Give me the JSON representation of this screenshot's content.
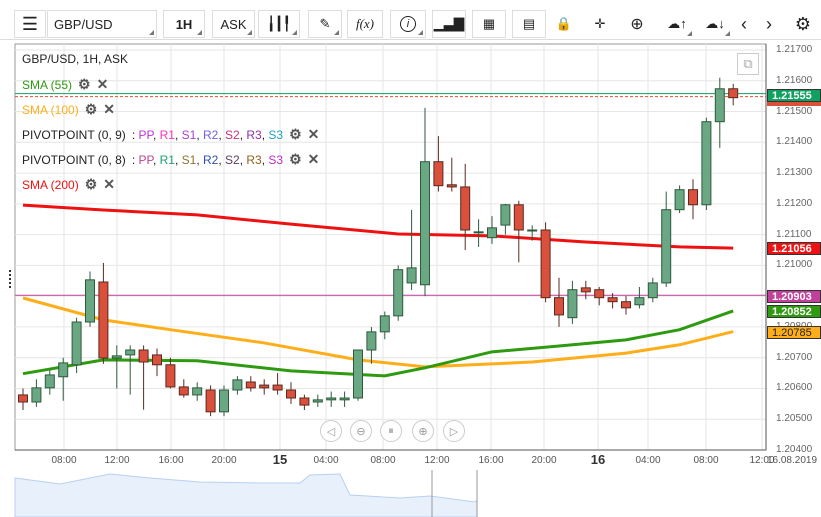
{
  "toolbar": {
    "symbol": "GBP/USD",
    "timeframe": "1H",
    "side": "ASK",
    "fx": "f(x)",
    "icons": [
      "menu-icon",
      "candlestick-icon",
      "pen-icon",
      "function-icon",
      "info-icon",
      "bar-chart-icon",
      "calendar-icon",
      "document-icon",
      "lock-icon",
      "crosshair-icon",
      "zoom-icon",
      "cloud-upload-icon",
      "cloud-download-icon",
      "chevron-left-icon",
      "chevron-right-icon",
      "gear-icon"
    ]
  },
  "legend": {
    "title": "GBP/USD, 1H, ASK",
    "sma55": "SMA (55)",
    "sma100": "SMA (100)",
    "sma200": "SMA (200)",
    "pivot9": {
      "label": "PIVOTPOINT (0, 9)",
      "items": [
        {
          "t": "PP",
          "c": "#c030e0"
        },
        {
          "t": "R1",
          "c": "#ff30c0"
        },
        {
          "t": "S1",
          "c": "#b040d0"
        },
        {
          "t": "R2",
          "c": "#7060e0"
        },
        {
          "t": "S2",
          "c": "#c03080"
        },
        {
          "t": "R3",
          "c": "#9030b0"
        },
        {
          "t": "S3",
          "c": "#20a0c0"
        }
      ]
    },
    "pivot8": {
      "label": "PIVOTPOINT (0, 8)",
      "items": [
        {
          "t": "PP",
          "c": "#c04090"
        },
        {
          "t": "R1",
          "c": "#20a070"
        },
        {
          "t": "S1",
          "c": "#907030"
        },
        {
          "t": "R2",
          "c": "#3050b0"
        },
        {
          "t": "S2",
          "c": "#604060"
        },
        {
          "t": "R3",
          "c": "#906020"
        },
        {
          "t": "S3",
          "c": "#c030c0"
        }
      ]
    }
  },
  "colors": {
    "up": "#6aa884",
    "down": "#d9513c",
    "sma55": "#2e9a10",
    "sma100": "#ffae1a",
    "sma200": "#ee1111",
    "pivot": "#c0409a",
    "price": "#10a060"
  },
  "yaxis": {
    "min": 1.204,
    "max": 1.217,
    "ticks": [
      "1.21700",
      "1.21600",
      "1.21500",
      "1.21400",
      "1.21300",
      "1.21200",
      "1.21100",
      "1.21000",
      "1.20900",
      "1.20800",
      "1.20700",
      "1.20600",
      "1.20500",
      "1.20400"
    ]
  },
  "tags": {
    "price": "1.21555",
    "sma200": "1.21056",
    "pivot": "1.20903",
    "sma55": "1.20852",
    "sma100": "1.20785"
  },
  "xaxis": [
    "08:00",
    "12:00",
    "16:00",
    "20:00",
    "15",
    "04:00",
    "08:00",
    "12:00",
    "16:00",
    "20:00",
    "16",
    "04:00",
    "08:00",
    "12:00",
    "16.08.2019"
  ],
  "chart_data": {
    "type": "candlestick",
    "pivot_level": 1.20903,
    "last_price": 1.21555,
    "candles": [
      [
        1.20579,
        1.206,
        1.2053,
        1.20556
      ],
      [
        1.20556,
        1.2063,
        1.2054,
        1.20602
      ],
      [
        1.20602,
        1.2066,
        1.2058,
        1.20644
      ],
      [
        1.20638,
        1.207,
        1.2056,
        1.20683
      ],
      [
        1.20677,
        1.2083,
        1.2065,
        1.20816
      ],
      [
        1.20816,
        1.2098,
        1.208,
        1.20953
      ],
      [
        1.20946,
        1.21008,
        1.2068,
        1.20699
      ],
      [
        1.20699,
        1.2074,
        1.206,
        1.20706
      ],
      [
        1.20709,
        1.2074,
        1.2058,
        1.20725
      ],
      [
        1.20725,
        1.2074,
        1.20531,
        1.20686
      ],
      [
        1.20709,
        1.2073,
        1.2064,
        1.20677
      ],
      [
        1.20677,
        1.207,
        1.206,
        1.20605
      ],
      [
        1.20605,
        1.2063,
        1.2057,
        1.20579
      ],
      [
        1.20579,
        1.2062,
        1.2056,
        1.20602
      ],
      [
        1.20595,
        1.2061,
        1.2051,
        1.20524
      ],
      [
        1.20524,
        1.2061,
        1.2051,
        1.20595
      ],
      [
        1.20595,
        1.2064,
        1.2058,
        1.20628
      ],
      [
        1.20621,
        1.2064,
        1.2059,
        1.20602
      ],
      [
        1.20611,
        1.2063,
        1.2058,
        1.20602
      ],
      [
        1.20611,
        1.2065,
        1.2058,
        1.20595
      ],
      [
        1.20595,
        1.2062,
        1.2055,
        1.20569
      ],
      [
        1.20569,
        1.2058,
        1.2053,
        1.20546
      ],
      [
        1.20556,
        1.2058,
        1.2054,
        1.20563
      ],
      [
        1.20563,
        1.2059,
        1.2054,
        1.20569
      ],
      [
        1.20563,
        1.2059,
        1.2054,
        1.20569
      ],
      [
        1.20569,
        1.2072,
        1.2056,
        1.20725
      ],
      [
        1.20725,
        1.208,
        1.2068,
        1.20784
      ],
      [
        1.20784,
        1.2085,
        1.2076,
        1.20836
      ],
      [
        1.20836,
        1.21,
        1.2082,
        1.20986
      ],
      [
        1.20943,
        1.2118,
        1.2092,
        1.20992
      ],
      [
        1.20937,
        1.21512,
        1.209,
        1.21337
      ],
      [
        1.21337,
        1.2142,
        1.2124,
        1.21259
      ],
      [
        1.21262,
        1.2135,
        1.2124,
        1.21255
      ],
      [
        1.21255,
        1.2133,
        1.2105,
        1.21115
      ],
      [
        1.21109,
        1.2115,
        1.2106,
        1.21109
      ],
      [
        1.2109,
        1.2116,
        1.2107,
        1.21122
      ],
      [
        1.21131,
        1.212,
        1.211,
        1.21197
      ],
      [
        1.21197,
        1.2121,
        1.2101,
        1.21115
      ],
      [
        1.21115,
        1.2113,
        1.2108,
        1.21115
      ],
      [
        1.21115,
        1.2114,
        1.2088,
        1.20895
      ],
      [
        1.20895,
        1.2096,
        1.208,
        1.20839
      ],
      [
        1.2083,
        1.2095,
        1.2081,
        1.20921
      ],
      [
        1.20927,
        1.2095,
        1.2089,
        1.20914
      ],
      [
        1.20921,
        1.2093,
        1.2087,
        1.20895
      ],
      [
        1.20895,
        1.2091,
        1.2086,
        1.20882
      ],
      [
        1.20882,
        1.209,
        1.2084,
        1.20862
      ],
      [
        1.20872,
        1.2093,
        1.2086,
        1.20895
      ],
      [
        1.20895,
        1.2096,
        1.2088,
        1.20943
      ],
      [
        1.20943,
        1.2124,
        1.2093,
        1.21181
      ],
      [
        1.21181,
        1.2126,
        1.2117,
        1.21246
      ],
      [
        1.21246,
        1.2128,
        1.2115,
        1.21197
      ],
      [
        1.21197,
        1.2148,
        1.2118,
        1.21467
      ],
      [
        1.21467,
        1.2161,
        1.21382,
        1.21574
      ],
      [
        1.21574,
        1.2159,
        1.2152,
        1.21545
      ]
    ],
    "sma55": [
      [
        0,
        1.20648
      ],
      [
        6,
        1.20693
      ],
      [
        13,
        1.2069
      ],
      [
        20,
        1.20657
      ],
      [
        27,
        1.20641
      ],
      [
        30,
        1.20667
      ],
      [
        35,
        1.20719
      ],
      [
        40,
        1.20738
      ],
      [
        45,
        1.20758
      ],
      [
        49,
        1.20791
      ],
      [
        53,
        1.20852
      ]
    ],
    "sma100": [
      [
        0,
        1.20894
      ],
      [
        6,
        1.20823
      ],
      [
        11,
        1.20791
      ],
      [
        18,
        1.20748
      ],
      [
        25,
        1.20693
      ],
      [
        30,
        1.2067
      ],
      [
        38,
        1.20686
      ],
      [
        45,
        1.20715
      ],
      [
        49,
        1.20742
      ],
      [
        53,
        1.20785
      ]
    ],
    "sma200": [
      [
        0,
        1.21196
      ],
      [
        6,
        1.2118
      ],
      [
        13,
        1.21164
      ],
      [
        20,
        1.21134
      ],
      [
        28,
        1.21102
      ],
      [
        35,
        1.21096
      ],
      [
        42,
        1.21076
      ],
      [
        49,
        1.2106
      ],
      [
        53,
        1.21056
      ]
    ]
  }
}
